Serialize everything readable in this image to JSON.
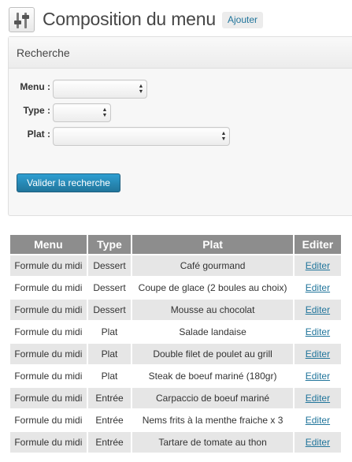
{
  "header": {
    "title": "Composition du menu",
    "add_label": "Ajouter"
  },
  "search": {
    "title": "Recherche",
    "menu_label": "Menu :",
    "type_label": "Type :",
    "plat_label": "Plat :",
    "menu_value": "",
    "type_value": "",
    "plat_value": "",
    "submit_label": "Valider la recherche"
  },
  "table": {
    "headers": [
      "Menu",
      "Type",
      "Plat",
      "Editer"
    ],
    "rows": [
      [
        "Formule du midi",
        "Dessert",
        "Café gourmand",
        "Editer"
      ],
      [
        "Formule du midi",
        "Dessert",
        "Coupe de glace (2 boules au choix)",
        "Editer"
      ],
      [
        "Formule du midi",
        "Dessert",
        "Mousse au chocolat",
        "Editer"
      ],
      [
        "Formule du midi",
        "Plat",
        "Salade landaise",
        "Editer"
      ],
      [
        "Formule du midi",
        "Plat",
        "Double filet de poulet au grill",
        "Editer"
      ],
      [
        "Formule du midi",
        "Plat",
        "Steak de boeuf mariné (180gr)",
        "Editer"
      ],
      [
        "Formule du midi",
        "Entrée",
        "Carpaccio de boeuf mariné",
        "Editer"
      ],
      [
        "Formule du midi",
        "Entrée",
        "Nems frits à la menthe fraiche x 3",
        "Editer"
      ],
      [
        "Formule du midi",
        "Entrée",
        "Tartare de tomate au thon",
        "Editer"
      ]
    ]
  },
  "colors": {
    "accent": "#21759b",
    "header_bg": "#8d8d8d",
    "row_alt": "#e6e6e6"
  },
  "icons": {
    "app": "settings-sliders-icon",
    "select": "select-arrows-icon"
  }
}
